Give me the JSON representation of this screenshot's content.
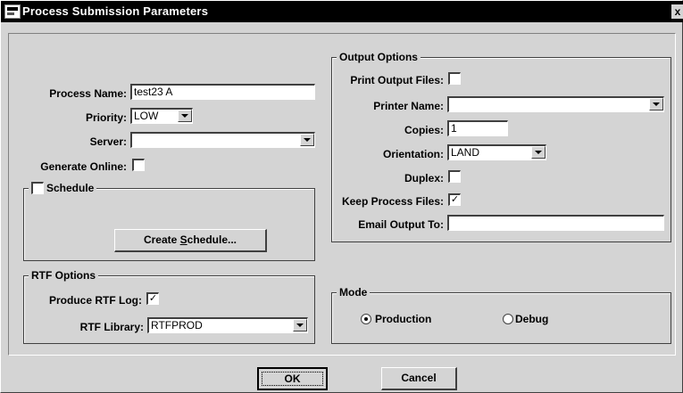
{
  "window": {
    "title": "Process Submission Parameters",
    "close_glyph": "x",
    "icon": "app-window-icon"
  },
  "left": {
    "process_name": {
      "label": "Process Name:",
      "value": "test23 A"
    },
    "priority": {
      "label": "Priority:",
      "value": "LOW"
    },
    "server": {
      "label": "Server:",
      "value": ""
    },
    "generate_online": {
      "label": "Generate Online:",
      "checked": false
    }
  },
  "schedule": {
    "label": "Schedule",
    "checked": false,
    "button_pre": "Create ",
    "button_underline": "S",
    "button_post": "chedule..."
  },
  "rtf": {
    "group_title": "RTF Options",
    "produce_log": {
      "label": "Produce RTF Log:",
      "checked": true
    },
    "library": {
      "label": "RTF Library:",
      "value": "RTFPROD"
    }
  },
  "output": {
    "group_title": "Output Options",
    "print_files": {
      "label": "Print Output Files:",
      "checked": false
    },
    "printer_name": {
      "label": "Printer Name:",
      "value": ""
    },
    "copies": {
      "label": "Copies:",
      "value": "1"
    },
    "orientation": {
      "label": "Orientation:",
      "value": "LAND"
    },
    "duplex": {
      "label": "Duplex:",
      "checked": false
    },
    "keep_files": {
      "label": "Keep Process Files:",
      "checked": true
    },
    "email_to": {
      "label": "Email Output To:",
      "value": ""
    }
  },
  "mode": {
    "group_title": "Mode",
    "options": [
      {
        "label": "Production",
        "selected": true
      },
      {
        "label": "Debug",
        "selected": false
      }
    ]
  },
  "buttons": {
    "ok": "OK",
    "cancel": "Cancel"
  },
  "check_glyph": "✓"
}
